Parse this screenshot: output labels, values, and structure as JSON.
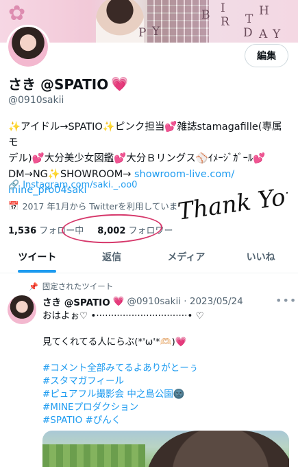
{
  "banner": {
    "birthday_letters": [
      "P",
      "Y",
      "B",
      "I",
      "R",
      "T",
      "H",
      "D",
      "A",
      "Y"
    ]
  },
  "profile": {
    "edit_label": "編集",
    "name": "さき @SPATIO",
    "handle": "@0910sakii",
    "bio_line1": "✨アイドル→SPATIO✨ピンク担当💕雑誌stamagafille(専属モ",
    "bio_line2": "デル)💕大分美少女図鑑💕大分Ｂリングス⚾️ｲﾒｰｼﾞｶﾞｰﾙ💕",
    "bio_line3_prefix": "DM→NG✨SHOWROOM→ ",
    "bio_link": "showroom-live.com/",
    "bio_link2": "mine_pro04saki",
    "website": "Instagram.com/saki._.oo0",
    "joined": "2017 年1月から Twitterを利用していま",
    "following_count": "1,536",
    "following_label": "フォロー中",
    "followers_count": "8,002",
    "followers_label": "フォロワー"
  },
  "tabs": [
    {
      "label": "ツイート",
      "active": true
    },
    {
      "label": "返信",
      "active": false
    },
    {
      "label": "メディア",
      "active": false
    },
    {
      "label": "いいね",
      "active": false
    }
  ],
  "pinned_label": "固定されたツイート",
  "tweet": {
    "name": "さき @SPATIO",
    "handle_date": "@0910sakii · 2023/05/24",
    "more": "•••",
    "line1": "おはよぉ♡ •·······························• ♡",
    "line2": "見てくれてる人にらぶ(*'ω'*🫶🏻)💗",
    "tags": [
      "#コメント全部みてるよありがとーぅ",
      "#スタマガフィール",
      "#ピュアフル撮影会 中之島公園🌚",
      "#MINEプロダクション",
      "#SPATIO #ぴんく"
    ]
  },
  "handwriting": "Thank You!",
  "colors": {
    "accent": "#1d9bf0",
    "annotation": "#d6386b",
    "heart": "#f0509a"
  }
}
